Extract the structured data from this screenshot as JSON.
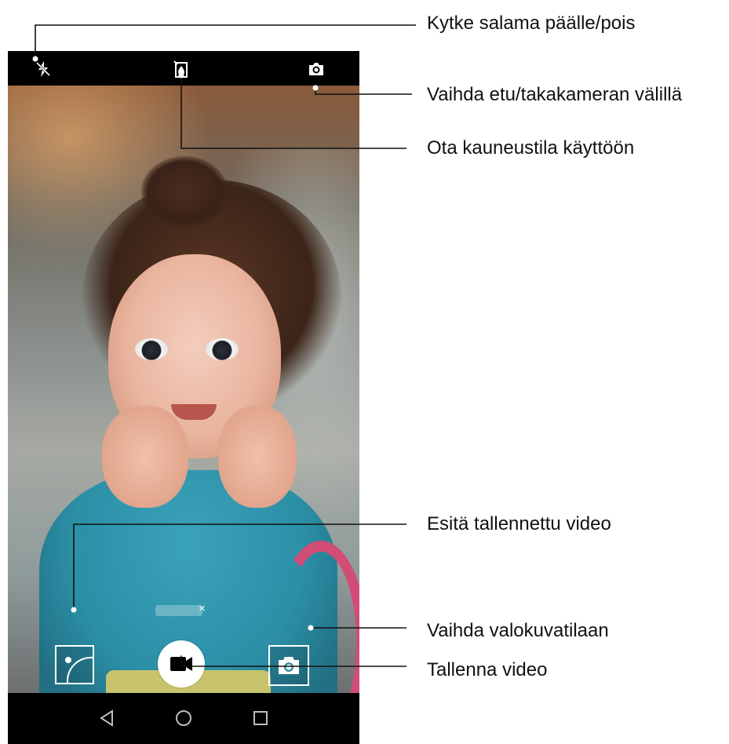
{
  "callouts": {
    "flash": "Kytke salama päälle/pois",
    "switch_camera": "Vaihda etu/takakameran välillä",
    "beauty": "Ota kauneustila käyttöön",
    "play_video": "Esitä tallennettu video",
    "photo_mode": "Vaihda valokuvatilaan",
    "record": "Tallenna video"
  },
  "icons": {
    "flash": "flash-off-icon",
    "beauty": "beauty-mode-icon",
    "switch_camera": "switch-camera-icon",
    "gallery_thumbnail": "gallery-thumbnail-icon",
    "record": "video-camera-icon",
    "photo_mode": "camera-icon",
    "nav_back": "back-triangle-icon",
    "nav_home": "home-circle-icon",
    "nav_recents": "recents-square-icon"
  },
  "toast": {
    "close": "×"
  },
  "colors": {
    "leader_line": "#111111",
    "ui_white": "#ffffff",
    "bar_black": "#000000"
  }
}
